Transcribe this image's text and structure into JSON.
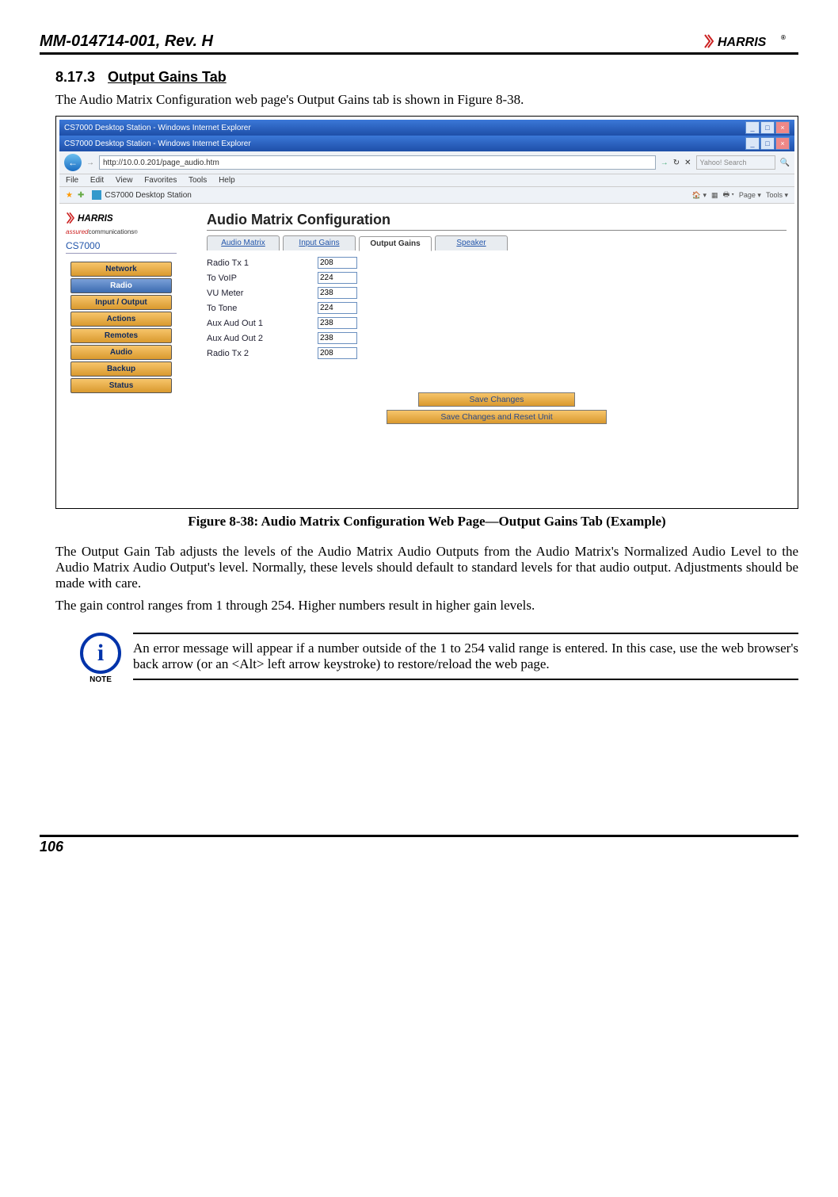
{
  "doc_id": "MM-014714-001, Rev. H",
  "logo_text": "HARRIS",
  "section_number": "8.17.3",
  "section_title": "Output Gains Tab",
  "intro": "The Audio Matrix Configuration web page's Output Gains tab is shown in Figure 8-38.",
  "figure_caption": "Figure 8-38:  Audio Matrix Configuration Web Page—Output Gains Tab (Example)",
  "para1": "The Output Gain Tab adjusts the levels of the Audio Matrix Audio Outputs from the Audio Matrix's Normalized Audio Level to the Audio Matrix Audio Output's level.  Normally, these levels should default to standard levels for that audio output.  Adjustments should be made with care.",
  "para2": "The gain control ranges from 1 through 254.  Higher numbers result in higher gain levels.",
  "note_label": "NOTE",
  "note_text": "An error message will appear if a number outside of the 1 to 254 valid range is entered.  In this case, use the web browser's back arrow (or an <Alt> left arrow keystroke) to restore/reload the web page.",
  "page_number": "106",
  "browser": {
    "title1": "CS7000 Desktop Station - Windows Internet Explorer",
    "title2": "CS7000 Desktop Station - Windows Internet Explorer",
    "url": "http://10.0.0.201/page_audio.htm",
    "menu": [
      "File",
      "Edit",
      "View",
      "Favorites",
      "Tools",
      "Help"
    ],
    "tab_label": "CS7000 Desktop Station",
    "search_placeholder": "Yahoo! Search",
    "toolbar_items": [
      "Page",
      "Tools"
    ]
  },
  "app": {
    "brand": "HARRIS",
    "brand_sub": "assuredcommunications",
    "model": "CS7000",
    "nav_items": [
      "Network",
      "Radio",
      "Input / Output",
      "Actions",
      "Remotes",
      "Audio",
      "Backup",
      "Status"
    ],
    "nav_active_index": 5,
    "page_title": "Audio Matrix Configuration",
    "tabs": [
      "Audio Matrix",
      "Input Gains",
      "Output Gains",
      "Speaker"
    ],
    "active_tab_index": 2,
    "rows": [
      {
        "label": "Radio Tx 1",
        "value": "208"
      },
      {
        "label": "To VoIP",
        "value": "224"
      },
      {
        "label": "VU Meter",
        "value": "238"
      },
      {
        "label": "To Tone",
        "value": "224"
      },
      {
        "label": "Aux Aud Out 1",
        "value": "238"
      },
      {
        "label": "Aux Aud Out 2",
        "value": "238"
      },
      {
        "label": "Radio Tx 2",
        "value": "208"
      }
    ],
    "save_label": "Save Changes",
    "save_reset_label": "Save Changes and Reset Unit"
  }
}
